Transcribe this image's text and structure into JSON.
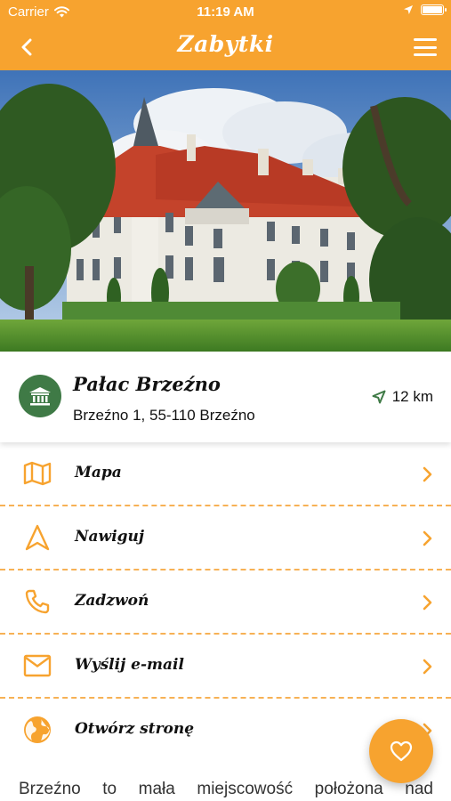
{
  "status_bar": {
    "carrier": "Carrier",
    "time": "11:19 AM"
  },
  "navbar": {
    "title": "Zabytki",
    "back_icon": "chevron-left-icon",
    "menu_icon": "hamburger-menu-icon"
  },
  "hero": {
    "image": "palace-photo"
  },
  "place": {
    "name": "Pałac Brzeźno",
    "address": "Brzeźno 1, 55-110 Brzeźno",
    "distance": "12 km",
    "category_icon": "monument-building-icon"
  },
  "actions": [
    {
      "label": "Mapa",
      "icon": "map-icon"
    },
    {
      "label": "Nawiguj",
      "icon": "navigation-arrow-icon"
    },
    {
      "label": "Zadzwoń",
      "icon": "phone-icon"
    },
    {
      "label": "Wyślij e-mail",
      "icon": "mail-icon"
    },
    {
      "label": "Otwórz stronę",
      "icon": "globe-icon"
    }
  ],
  "description": "Brzeźno to mała miejscowość położona nad",
  "fab": {
    "icon": "heart-icon"
  },
  "colors": {
    "accent": "#f7a32f",
    "category_green": "#3f7a46"
  }
}
